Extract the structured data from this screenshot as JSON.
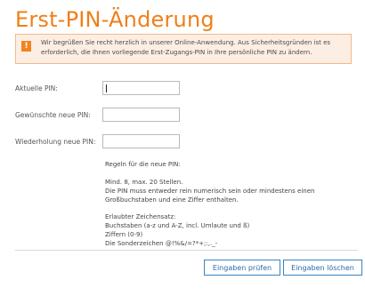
{
  "page": {
    "title": "Erst-PIN-Änderung"
  },
  "notice": {
    "icon": "warning-icon",
    "line1": "Wir begrüßen Sie recht herzlich in unserer Online-Anwendung. Aus Sicherheitsgründen ist es",
    "line2": "erforderlich, die Ihnen vorliegende Erst-Zugangs-PIN in Ihre persönliche PIN zu ändern."
  },
  "form": {
    "current_pin_label": "Aktuelle PIN:",
    "current_pin_value": "",
    "new_pin_label": "Gewünschte neue PIN:",
    "new_pin_value": "",
    "repeat_pin_label": "Wiederholung neue PIN:",
    "repeat_pin_value": ""
  },
  "rules": {
    "heading": "Regeln für die neue PIN:",
    "line1": "Mind. 8, max. 20 Stellen.",
    "line2": "Die PIN muss entweder rein numerisch sein oder mindestens einen",
    "line3": "Großbuchstaben und eine Ziffer enthalten.",
    "charset_heading": "Erlaubter Zeichensatz:",
    "charset1": "Buchstaben (a-z und A-Z, incl. Umlaute und ß)",
    "charset2": "Ziffern (0-9)",
    "charset3": "Die Sonderzeichen @!%&/=?*+;:,._-"
  },
  "buttons": {
    "check": "Eingaben prüfen",
    "clear": "Eingaben löschen"
  },
  "colors": {
    "accent": "#ef7f1a",
    "notice_bg": "#fdeee3",
    "button_border": "#3b83c4"
  }
}
